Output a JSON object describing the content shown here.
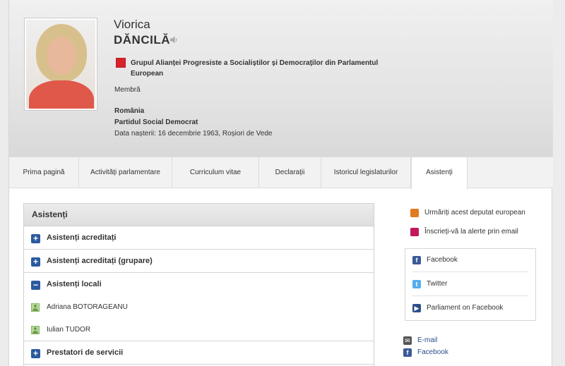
{
  "mep": {
    "first_name": "Viorica",
    "last_name": "DĂNCILĂ",
    "group": "Grupul Alianței Progresiste a Socialiștilor și Democraților din Parlamentul European",
    "role": "Membră",
    "country": "România",
    "party": "Partidul Social Democrat",
    "birth": "Data nașterii: 16 decembrie 1963, Roșiori de Vede"
  },
  "tabs": [
    {
      "label": "Prima pagină"
    },
    {
      "label": "Activități parlamentare"
    },
    {
      "label": "Curriculum vitae"
    },
    {
      "label": "Declarații"
    },
    {
      "label": "Istoricul legislaturilor"
    },
    {
      "label": "Asistenți"
    }
  ],
  "panel": {
    "title": "Asistenți",
    "sections": [
      {
        "label": "Asistenți acreditați",
        "icon": "+"
      },
      {
        "label": "Asistenți acreditați (grupare)",
        "icon": "+"
      },
      {
        "label": "Asistenți locali",
        "icon": "−"
      }
    ],
    "local_assistants": [
      "Adriana BOTORAGEANU",
      "Iulian TUDOR"
    ],
    "services": {
      "label": "Prestatori de servicii",
      "icon": "+"
    }
  },
  "sidebar": {
    "follow": "Urmăriți acest deputat european",
    "alerts": "Înscrieți-vă la alerte prin email",
    "social": [
      "Facebook",
      "Twitter",
      "Parliament on Facebook"
    ],
    "contacts": [
      "E-mail",
      "Facebook"
    ]
  },
  "colors": {
    "accent": "#2b5a9e",
    "rss": "#e07b1f",
    "alert": "#c2185b",
    "group_logo": "#d8232a"
  }
}
